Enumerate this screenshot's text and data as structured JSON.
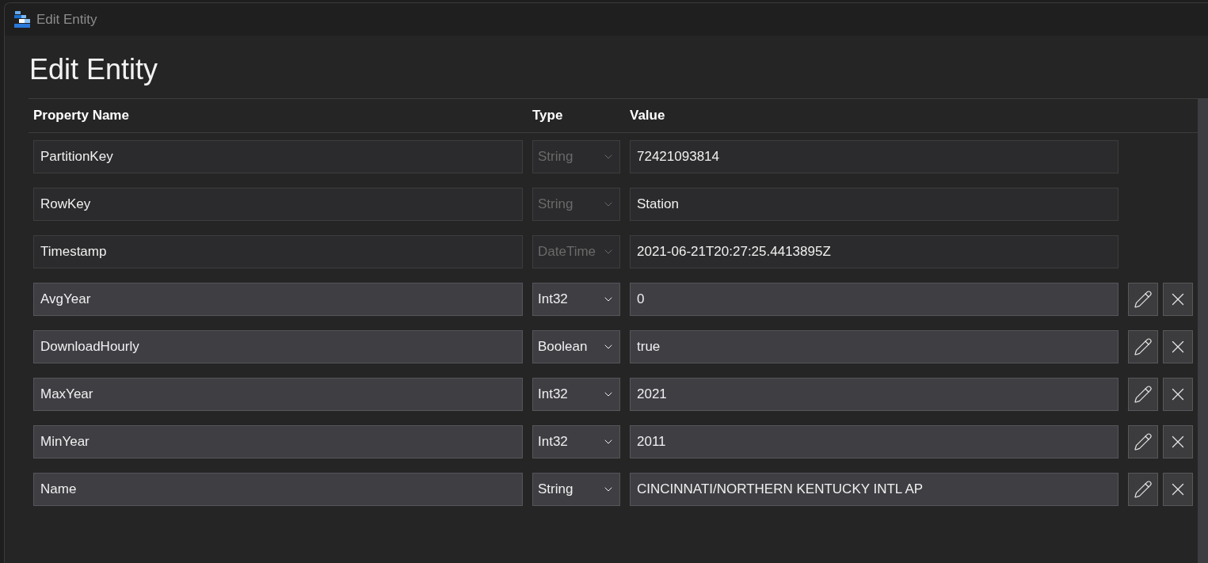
{
  "window": {
    "title": "Edit Entity"
  },
  "heading": "Edit Entity",
  "table": {
    "columns": [
      "Property Name",
      "Type",
      "Value"
    ],
    "rows": [
      {
        "name": "PartitionKey",
        "type": "String",
        "value": "72421093814",
        "disabled": true
      },
      {
        "name": "RowKey",
        "type": "String",
        "value": "Station",
        "disabled": true
      },
      {
        "name": "Timestamp",
        "type": "DateTime",
        "value": "2021-06-21T20:27:25.4413895Z",
        "disabled": true
      },
      {
        "name": "AvgYear",
        "type": "Int32",
        "value": "0",
        "disabled": false
      },
      {
        "name": "DownloadHourly",
        "type": "Boolean",
        "value": "true",
        "disabled": false
      },
      {
        "name": "MaxYear",
        "type": "Int32",
        "value": "2021",
        "disabled": false
      },
      {
        "name": "MinYear",
        "type": "Int32",
        "value": "2011",
        "disabled": false
      },
      {
        "name": "Name",
        "type": "String",
        "value": "CINCINNATI/NORTHERN KENTUCKY INTL AP",
        "disabled": false
      }
    ]
  }
}
